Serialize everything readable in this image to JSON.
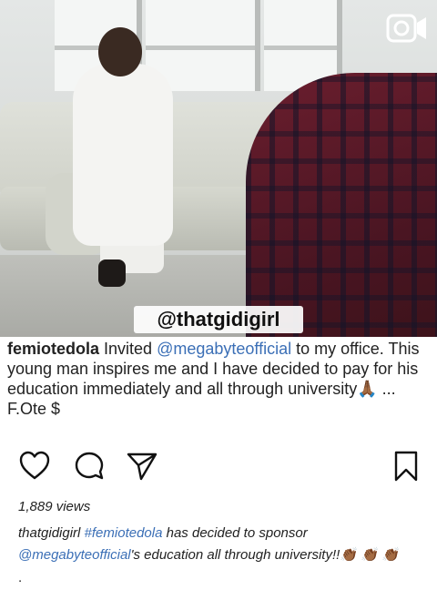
{
  "post": {
    "watermark": "@thatgidigirl",
    "overlay_caption": {
      "username": "femiotedola",
      "text_before": " Invited ",
      "mention": "@megabyteofficial",
      "text_after": " to my office. This young man inspires me and I have decided to pay for his education immediately and all through university",
      "emoji": "🙏🏾",
      "signature": " ... F.Ote $"
    },
    "views": "1,889 views",
    "caption": {
      "username": "thatgidigirl",
      "hashtag": "#femiotedola",
      "text1": " has decided to sponsor",
      "mention": "@megabyteofficial",
      "text2": "'s education all through university!!",
      "emoji": "👏🏾 👏🏾 👏🏾",
      "trailing": "."
    }
  },
  "icons": {
    "video": "video-camera-icon",
    "like": "heart-icon",
    "comment": "comment-icon",
    "share": "send-icon",
    "save": "bookmark-icon"
  }
}
